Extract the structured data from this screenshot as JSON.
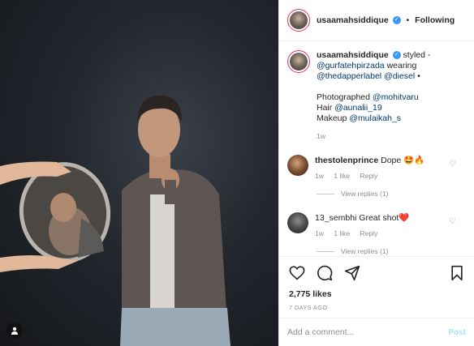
{
  "header": {
    "username": "usaamahsiddique",
    "follow_status": "Following",
    "separator": "•"
  },
  "caption": {
    "username": "usaamahsiddique",
    "line1": "styled -",
    "handle1": "@gurfatehpirzada",
    "line2": "wearing",
    "handle2": "@thedapperlabel",
    "handle3": "@diesel",
    "bullet": "•",
    "photographed_label": "Photographed",
    "handle4": "@mohitvaru",
    "hair_label": "Hair",
    "handle5": "@aunalii_19",
    "makeup_label": "Makeup",
    "handle6": "@mulaikah_s",
    "time": "1w"
  },
  "comments": [
    {
      "username": "thestolenprince",
      "text": "Dope 🤩🔥",
      "time": "1w",
      "likes": "1 like",
      "reply": "Reply",
      "view_replies": "View replies (1)"
    },
    {
      "username": "13_sembhi",
      "text": "Great shot❤️",
      "time": "1w",
      "likes": "1 like",
      "reply": "Reply",
      "view_replies": "View replies (1)"
    }
  ],
  "likes": "2,775 likes",
  "posted": "7 DAYS AGO",
  "add_comment": {
    "placeholder": "Add a comment...",
    "post_label": "Post"
  },
  "icons": {
    "like": "heart-icon",
    "comment": "comment-icon",
    "share": "share-icon",
    "save": "bookmark-icon",
    "tag": "user-tag-icon"
  },
  "colors": {
    "verified": "#3897f0",
    "link": "#00376b",
    "post_disabled": "#b2dffc",
    "muted": "#8e8e8e"
  }
}
